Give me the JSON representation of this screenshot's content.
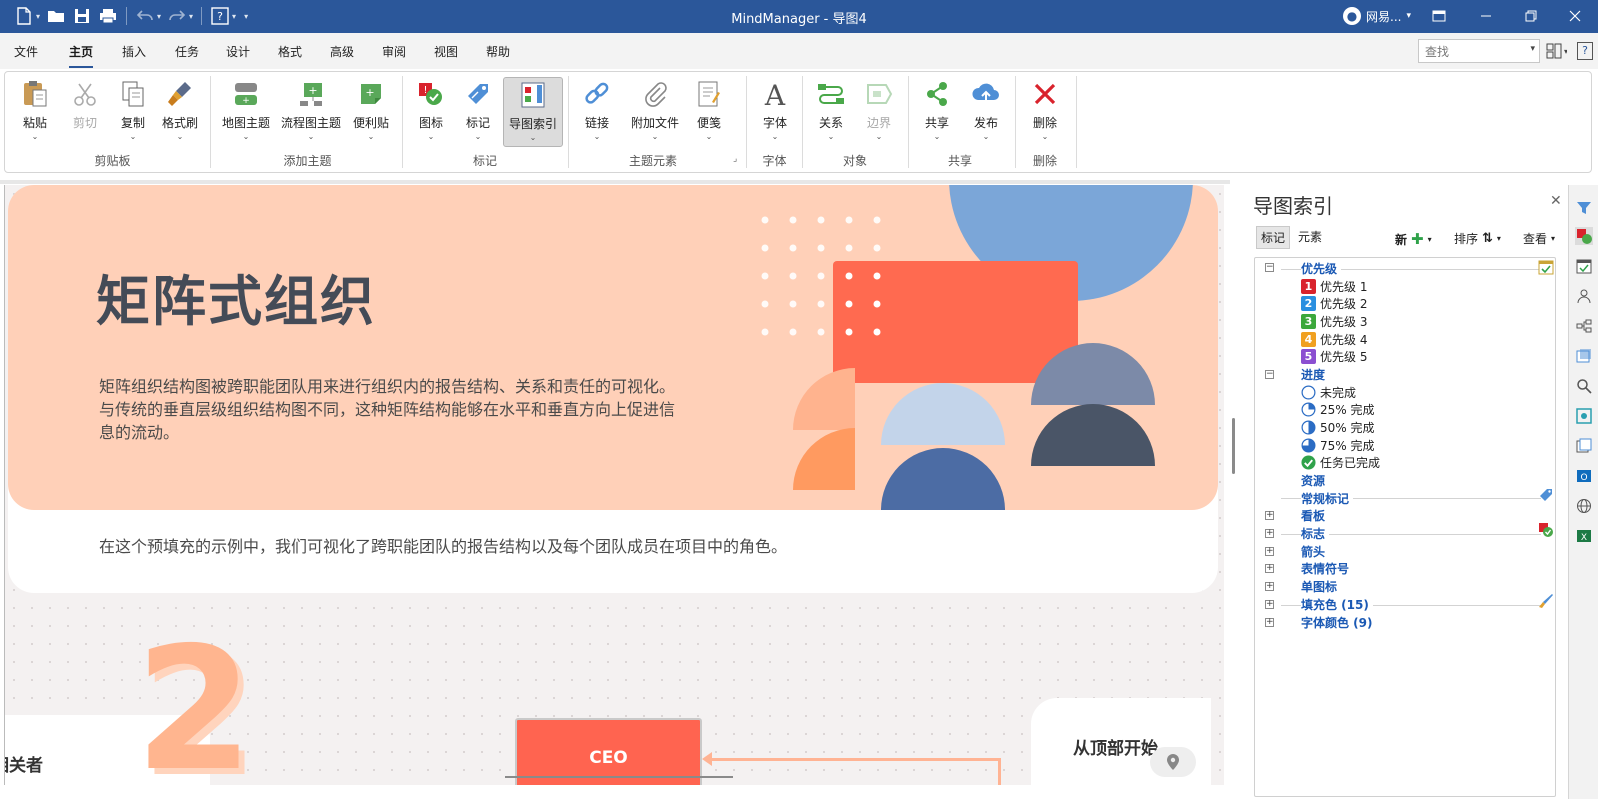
{
  "window": {
    "title": "MindManager - 导图4",
    "user": "网易...",
    "controls": [
      "restore-ribbon",
      "minimize",
      "maximize",
      "close"
    ]
  },
  "menu": {
    "tabs": [
      "文件",
      "主页",
      "插入",
      "任务",
      "设计",
      "格式",
      "高级",
      "审阅",
      "视图",
      "帮助"
    ],
    "active": "主页",
    "search_placeholder": "查找"
  },
  "ribbon": {
    "buttons": {
      "paste": "粘贴",
      "cut": "剪切",
      "copy": "复制",
      "format_painter": "格式刷",
      "map_topic": "地图主题",
      "flow_topic": "流程图主题",
      "sticky": "便利贴",
      "icons": "图标",
      "tags": "标记",
      "map_index": "导图索引",
      "link": "链接",
      "attach": "附加文件",
      "notes": "便笺",
      "font": "字体",
      "relation": "关系",
      "boundary": "边界",
      "share": "共享",
      "publish": "发布",
      "delete": "删除"
    },
    "groups": {
      "clipboard": "剪贴板",
      "add_topic": "添加主题",
      "markers": "标记",
      "topic_elements": "主题元素",
      "font": "字体",
      "objects": "对象",
      "share": "共享",
      "delete": "删除"
    }
  },
  "canvas": {
    "hero_title": "矩阵式组织",
    "hero_desc_1": "矩阵组织结构图被跨职能团队用来进行组织内的报告结构、关系和责任的可视化。",
    "hero_desc_2": "与传统的垂直层级组织结构图不同，这种矩阵结构能够在水平和垂直方向上促进信",
    "hero_desc_3": "息的流动。",
    "hero_footer": "在这个预填充的示例中，我们可视化了跨职能团队的报告结构以及每个团队成员在项目中的角色。",
    "step_number": "2",
    "left_card": "相关者",
    "ceo_label": "CEO",
    "right_card": "从顶部开始"
  },
  "panel": {
    "title": "导图索引",
    "tabs": [
      "标记",
      "元素"
    ],
    "active_tab": "标记",
    "tools": {
      "new": "新",
      "sort": "排序",
      "view": "查看"
    },
    "tree": {
      "priority": {
        "label": "优先级",
        "items": [
          {
            "num": "1",
            "label": "优先级 1",
            "color": "#d9232d"
          },
          {
            "num": "2",
            "label": "优先级 2",
            "color": "#2a8fe0"
          },
          {
            "num": "3",
            "label": "优先级 3",
            "color": "#3ca83c"
          },
          {
            "num": "4",
            "label": "优先级 4",
            "color": "#f0a020"
          },
          {
            "num": "5",
            "label": "优先级 5",
            "color": "#8b4fd1"
          }
        ]
      },
      "progress": {
        "label": "进度",
        "items": [
          {
            "label": "未完成",
            "fraction": 0
          },
          {
            "label": "25% 完成",
            "fraction": 0.25
          },
          {
            "label": "50% 完成",
            "fraction": 0.5
          },
          {
            "label": "75% 完成",
            "fraction": 0.75
          },
          {
            "label": "任务已完成",
            "fraction": 1
          }
        ]
      },
      "resources": "资源",
      "general_tags": "常规标记",
      "kanban": "看板",
      "flags": "标志",
      "arrows": "箭头",
      "emoji": "表情符号",
      "single_icons": "单图标",
      "fill_color": "填充色 (15)",
      "font_color": "字体颜色 (9)"
    }
  },
  "colors": {
    "title_bar": "#2b579a",
    "hero_bg": "#ffd0b8",
    "accent_red": "#ff6450",
    "link_blue": "#1b59b4"
  }
}
